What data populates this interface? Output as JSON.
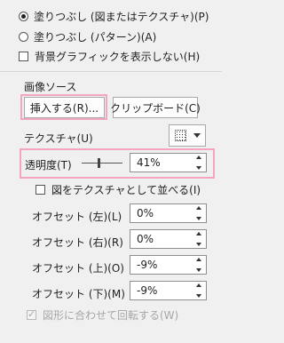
{
  "fill": {
    "picture_fill": "塗りつぶし (図またはテクスチャ)(P)",
    "pattern_fill": "塗りつぶし (パターン)(A)",
    "slide_background_fill": "背景グラフィックを表示しない(H)"
  },
  "picture_source": {
    "heading": "画像ソース",
    "insert_button": "挿入する(R)...",
    "clipboard_button": "クリップボード(C)"
  },
  "texture": {
    "label": "テクスチャ(U)"
  },
  "transparency": {
    "label": "透明度(T)",
    "value": "41%",
    "level": 41
  },
  "tile": {
    "label": "図をテクスチャとして並べる(I)"
  },
  "offsets": [
    {
      "label": "オフセット (左)(L)",
      "value": "0%"
    },
    {
      "label": "オフセット (右)(R)",
      "value": "0%"
    },
    {
      "label": "オフセット (上)(O)",
      "value": "-9%"
    },
    {
      "label": "オフセット (下)(M)",
      "value": "-9%"
    }
  ],
  "rotate_with_shape": {
    "label": "図形に合わせて回転する(W)"
  },
  "colors": {
    "highlight": "#f2a6c2"
  }
}
